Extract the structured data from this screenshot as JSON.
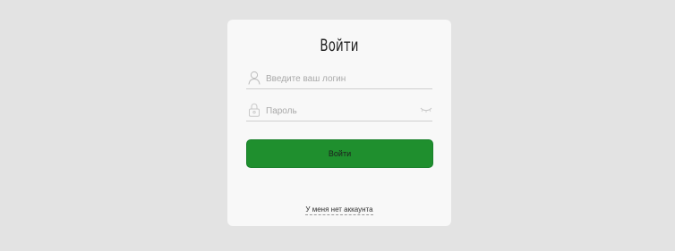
{
  "login_form": {
    "title": "Войти",
    "login_field": {
      "value": "",
      "placeholder": "Введите ваш логин",
      "icon": "user-icon"
    },
    "password_field": {
      "value": "",
      "placeholder": "Пароль",
      "icon": "lock-icon",
      "toggle_icon": "eye-closed-icon"
    },
    "submit_label": "Войти",
    "no_account_link": "У меня нет аккаунта"
  },
  "colors": {
    "background": "#e3e3e3",
    "card": "#f8f8f8",
    "accent": "#1f8f2e"
  }
}
